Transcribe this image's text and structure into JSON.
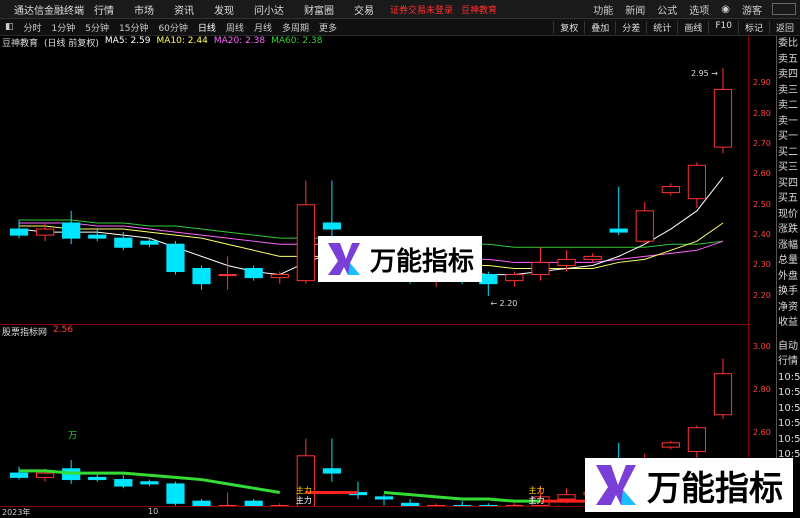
{
  "menubar": {
    "title": "通达信金融终端",
    "items": [
      "行情",
      "市场",
      "资讯",
      "发现",
      "问小达",
      "财富圈",
      "交易"
    ],
    "warning": "证券交易未登录",
    "brand": "豆神教育",
    "right_items": [
      "功能",
      "新闻",
      "公式",
      "选项"
    ],
    "guest": "游客"
  },
  "tabbar": {
    "periods": [
      "分时",
      "1分钟",
      "5分钟",
      "15分钟",
      "60分钟",
      "日线",
      "周线",
      "月线",
      "多周期",
      "更多"
    ],
    "active_period": "日线",
    "right_buttons": [
      "复权",
      "叠加",
      "分差",
      "统计",
      "画线",
      "F10",
      "标记",
      "返回"
    ]
  },
  "main_legend": {
    "stock": "豆神教育",
    "mode": "(日线 前复权)",
    "ma5": "MA5: 2.59",
    "ma10": "MA10: 2.44",
    "ma20": "MA20: 2.38",
    "ma60": "MA60: 2.38"
  },
  "indicator_legend": {
    "name": "股票指标网",
    "value": "2.56"
  },
  "right_panel": {
    "labels_top": [
      "委比",
      "卖五",
      "卖四",
      "卖三",
      "卖二",
      "卖一",
      "买一",
      "买二",
      "买三",
      "买四",
      "买五",
      "现价",
      "涨跌",
      "涨幅",
      "总量",
      "外盘",
      "换手",
      "净资",
      "收益"
    ],
    "labels_bottom": [
      "自动",
      "行情",
      "10:5",
      "10:5",
      "10:5",
      "10:5",
      "10:5",
      "10:5",
      "10:5",
      "10:5"
    ]
  },
  "watermark": {
    "text": "万能指标"
  },
  "annotations": {
    "high": "2.95",
    "low": "2.20",
    "wan": "万",
    "zhuli": "主力"
  },
  "bottom_axis": {
    "year": "2023年",
    "month": "10"
  },
  "colors": {
    "up": "#ff3333",
    "down": "#00e5ff",
    "ma5": "#ffffff",
    "ma10": "#ffff66",
    "ma20": "#ff66ff",
    "ma60": "#33cc33",
    "axis": "#8b0000"
  },
  "chart_data": {
    "type": "candlestick",
    "ylim": [
      2.15,
      3.0
    ],
    "yticks": [
      2.2,
      2.3,
      2.4,
      2.5,
      2.6,
      2.7,
      2.8,
      2.9
    ],
    "candles": [
      {
        "o": 2.42,
        "h": 2.45,
        "l": 2.39,
        "c": 2.4
      },
      {
        "o": 2.4,
        "h": 2.44,
        "l": 2.38,
        "c": 2.42
      },
      {
        "o": 2.44,
        "h": 2.48,
        "l": 2.37,
        "c": 2.39
      },
      {
        "o": 2.4,
        "h": 2.42,
        "l": 2.38,
        "c": 2.39
      },
      {
        "o": 2.39,
        "h": 2.41,
        "l": 2.35,
        "c": 2.36
      },
      {
        "o": 2.38,
        "h": 2.39,
        "l": 2.36,
        "c": 2.37
      },
      {
        "o": 2.37,
        "h": 2.38,
        "l": 2.27,
        "c": 2.28
      },
      {
        "o": 2.29,
        "h": 2.3,
        "l": 2.22,
        "c": 2.24
      },
      {
        "o": 2.27,
        "h": 2.33,
        "l": 2.22,
        "c": 2.27
      },
      {
        "o": 2.29,
        "h": 2.3,
        "l": 2.25,
        "c": 2.26
      },
      {
        "o": 2.26,
        "h": 2.28,
        "l": 2.24,
        "c": 2.27
      },
      {
        "o": 2.25,
        "h": 2.58,
        "l": 2.24,
        "c": 2.5
      },
      {
        "o": 2.44,
        "h": 2.58,
        "l": 2.38,
        "c": 2.42
      },
      {
        "o": 2.33,
        "h": 2.38,
        "l": 2.3,
        "c": 2.32
      },
      {
        "o": 2.31,
        "h": 2.32,
        "l": 2.27,
        "c": 2.3
      },
      {
        "o": 2.28,
        "h": 2.3,
        "l": 2.24,
        "c": 2.26
      },
      {
        "o": 2.26,
        "h": 2.28,
        "l": 2.23,
        "c": 2.27
      },
      {
        "o": 2.27,
        "h": 2.29,
        "l": 2.24,
        "c": 2.26
      },
      {
        "o": 2.27,
        "h": 2.28,
        "l": 2.2,
        "c": 2.24
      },
      {
        "o": 2.25,
        "h": 2.28,
        "l": 2.23,
        "c": 2.27
      },
      {
        "o": 2.27,
        "h": 2.36,
        "l": 2.25,
        "c": 2.31
      },
      {
        "o": 2.3,
        "h": 2.35,
        "l": 2.28,
        "c": 2.32
      },
      {
        "o": 2.32,
        "h": 2.34,
        "l": 2.31,
        "c": 2.33
      },
      {
        "o": 2.42,
        "h": 2.56,
        "l": 2.4,
        "c": 2.41
      },
      {
        "o": 2.38,
        "h": 2.51,
        "l": 2.37,
        "c": 2.48
      },
      {
        "o": 2.54,
        "h": 2.57,
        "l": 2.53,
        "c": 2.56
      },
      {
        "o": 2.52,
        "h": 2.64,
        "l": 2.49,
        "c": 2.63
      },
      {
        "o": 2.69,
        "h": 2.95,
        "l": 2.67,
        "c": 2.88
      }
    ],
    "ma5": [
      2.42,
      2.41,
      2.41,
      2.41,
      2.4,
      2.39,
      2.36,
      2.33,
      2.3,
      2.28,
      2.27,
      2.31,
      2.34,
      2.36,
      2.37,
      2.34,
      2.3,
      2.28,
      2.27,
      2.27,
      2.28,
      2.29,
      2.3,
      2.33,
      2.37,
      2.42,
      2.48,
      2.59
    ],
    "ma10": [
      2.43,
      2.43,
      2.42,
      2.42,
      2.42,
      2.41,
      2.4,
      2.39,
      2.37,
      2.35,
      2.33,
      2.33,
      2.33,
      2.33,
      2.33,
      2.32,
      2.31,
      2.3,
      2.3,
      2.29,
      2.29,
      2.29,
      2.29,
      2.31,
      2.32,
      2.35,
      2.38,
      2.44
    ],
    "ma20": [
      2.44,
      2.44,
      2.44,
      2.43,
      2.43,
      2.42,
      2.41,
      2.4,
      2.39,
      2.38,
      2.37,
      2.37,
      2.37,
      2.36,
      2.35,
      2.34,
      2.33,
      2.32,
      2.32,
      2.31,
      2.31,
      2.31,
      2.31,
      2.32,
      2.33,
      2.34,
      2.35,
      2.38
    ],
    "ma60": [
      2.45,
      2.45,
      2.45,
      2.44,
      2.44,
      2.43,
      2.43,
      2.42,
      2.41,
      2.4,
      2.39,
      2.39,
      2.39,
      2.38,
      2.38,
      2.38,
      2.37,
      2.37,
      2.37,
      2.36,
      2.36,
      2.36,
      2.36,
      2.36,
      2.36,
      2.37,
      2.37,
      2.38
    ]
  }
}
